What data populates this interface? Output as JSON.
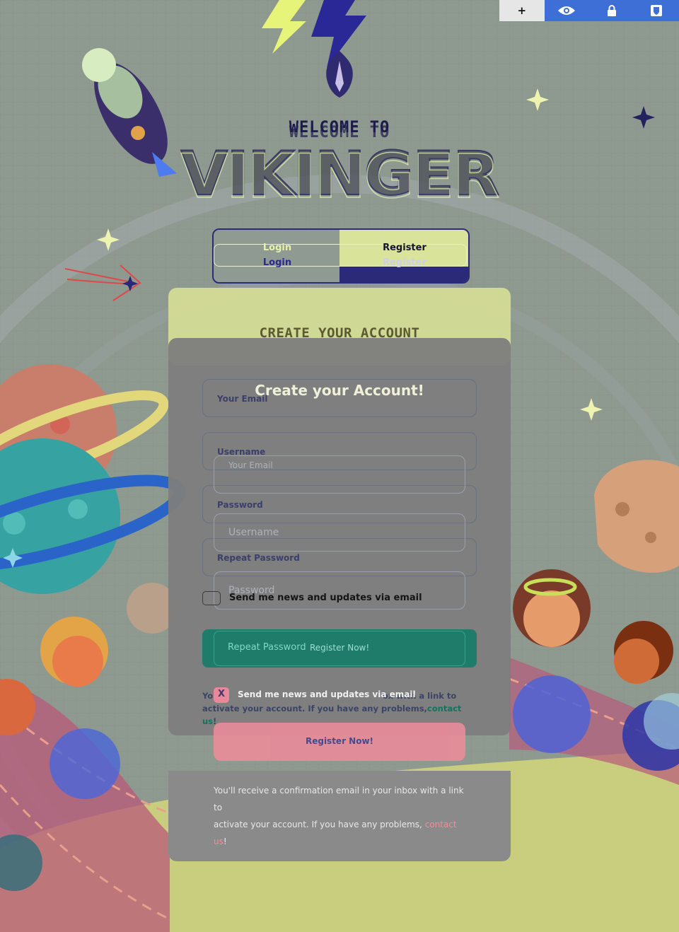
{
  "toolbar": {
    "add_label": "+",
    "icons": [
      "eye-icon",
      "lock-icon",
      "bitwarden-icon"
    ]
  },
  "headline": {
    "welcome": "WELCOME TO",
    "brand": "VIKINGER"
  },
  "tabs": {
    "login": "Login",
    "register": "Register"
  },
  "card": {
    "title": "CREATE YOUR ACCOUNT",
    "subtitle": "Create your Account!",
    "fields": {
      "email": "Your Email",
      "username": "Username",
      "password": "Password",
      "repeat_password": "Repeat Password"
    },
    "newsletter_label": "Send me news and updates via email",
    "register_button": "Register Now!",
    "confirmation_prefix": "You'll receive a confirmation email in your inbox with a link to activate your account. If you have any problems,",
    "contact_link": "contact us",
    "confirmation_suffix": "!",
    "note_overlay_start": "You",
    "note_overlay_mid": "re",
    "note_overlay_end": "ox with a link to",
    "note_line2": "activate your account. If you have any problems,",
    "x_mark": "X"
  },
  "lower": {
    "confirmation_line1": "You'll receive a confirmation email in your inbox with a link to",
    "confirmation_line2": "activate your account. If you have any problems,",
    "contact_link": "contact us",
    "suffix": "!"
  },
  "colors": {
    "accent_green": "#1f7c6b",
    "accent_pink": "#f08c9b",
    "accent_lime": "#d9e39a",
    "navy": "#2b2a78"
  }
}
